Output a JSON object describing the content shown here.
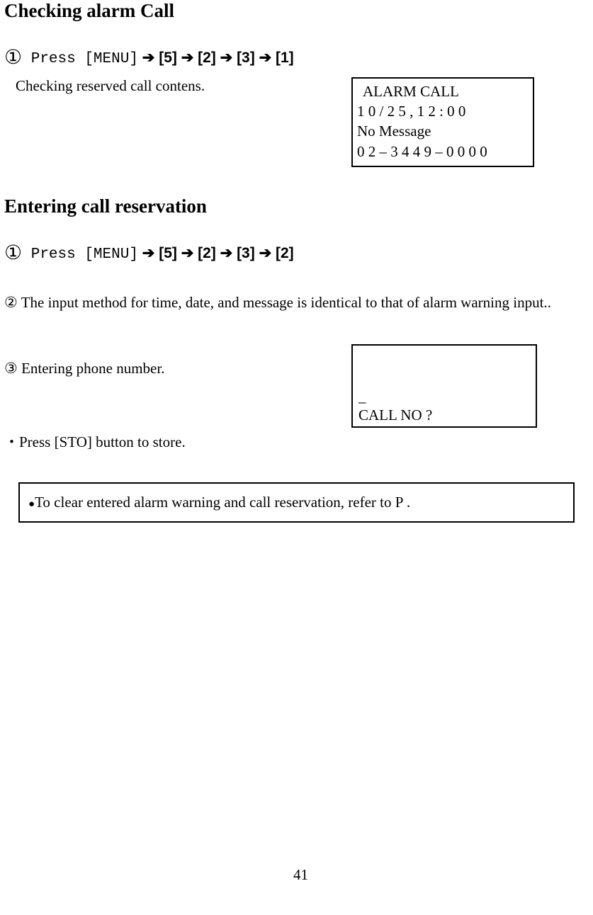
{
  "section1": {
    "heading": "Checking alarm Call",
    "step1_num": "①",
    "step1_press": " Press [MENU]",
    "step1_seq": " ➔ [5] ➔ [2] ➔ [3] ➔ [1]",
    "sub": "Checking reserved call contens."
  },
  "lcd1": {
    "l1": "ALARM CALL",
    "l2": "1 0 / 2 5 , 1 2 : 0 0",
    "l3": "No Message",
    "l4": "0 2 – 3 4 4 9 – 0 0 0 0"
  },
  "section2": {
    "heading": "Entering call reservation",
    "step1_num": "①",
    "step1_press": " Press [MENU]",
    "step1_seq": " ➔ [5] ➔ [2] ➔ [3] ➔ [2]",
    "step2_num": "②",
    "step2_text": " The input method for time, date, and message is identical to that of alarm warning input..",
    "step3_num": "③",
    "step3_text": " Entering phone number.",
    "store_text": "・Press [STO] button to store."
  },
  "lcd2": {
    "l1": "_",
    "l2": "CALL NO ?"
  },
  "note": {
    "bullet": "●",
    "text": "To clear entered alarm warning and call reservation, refer to P  ."
  },
  "page_number": "41"
}
